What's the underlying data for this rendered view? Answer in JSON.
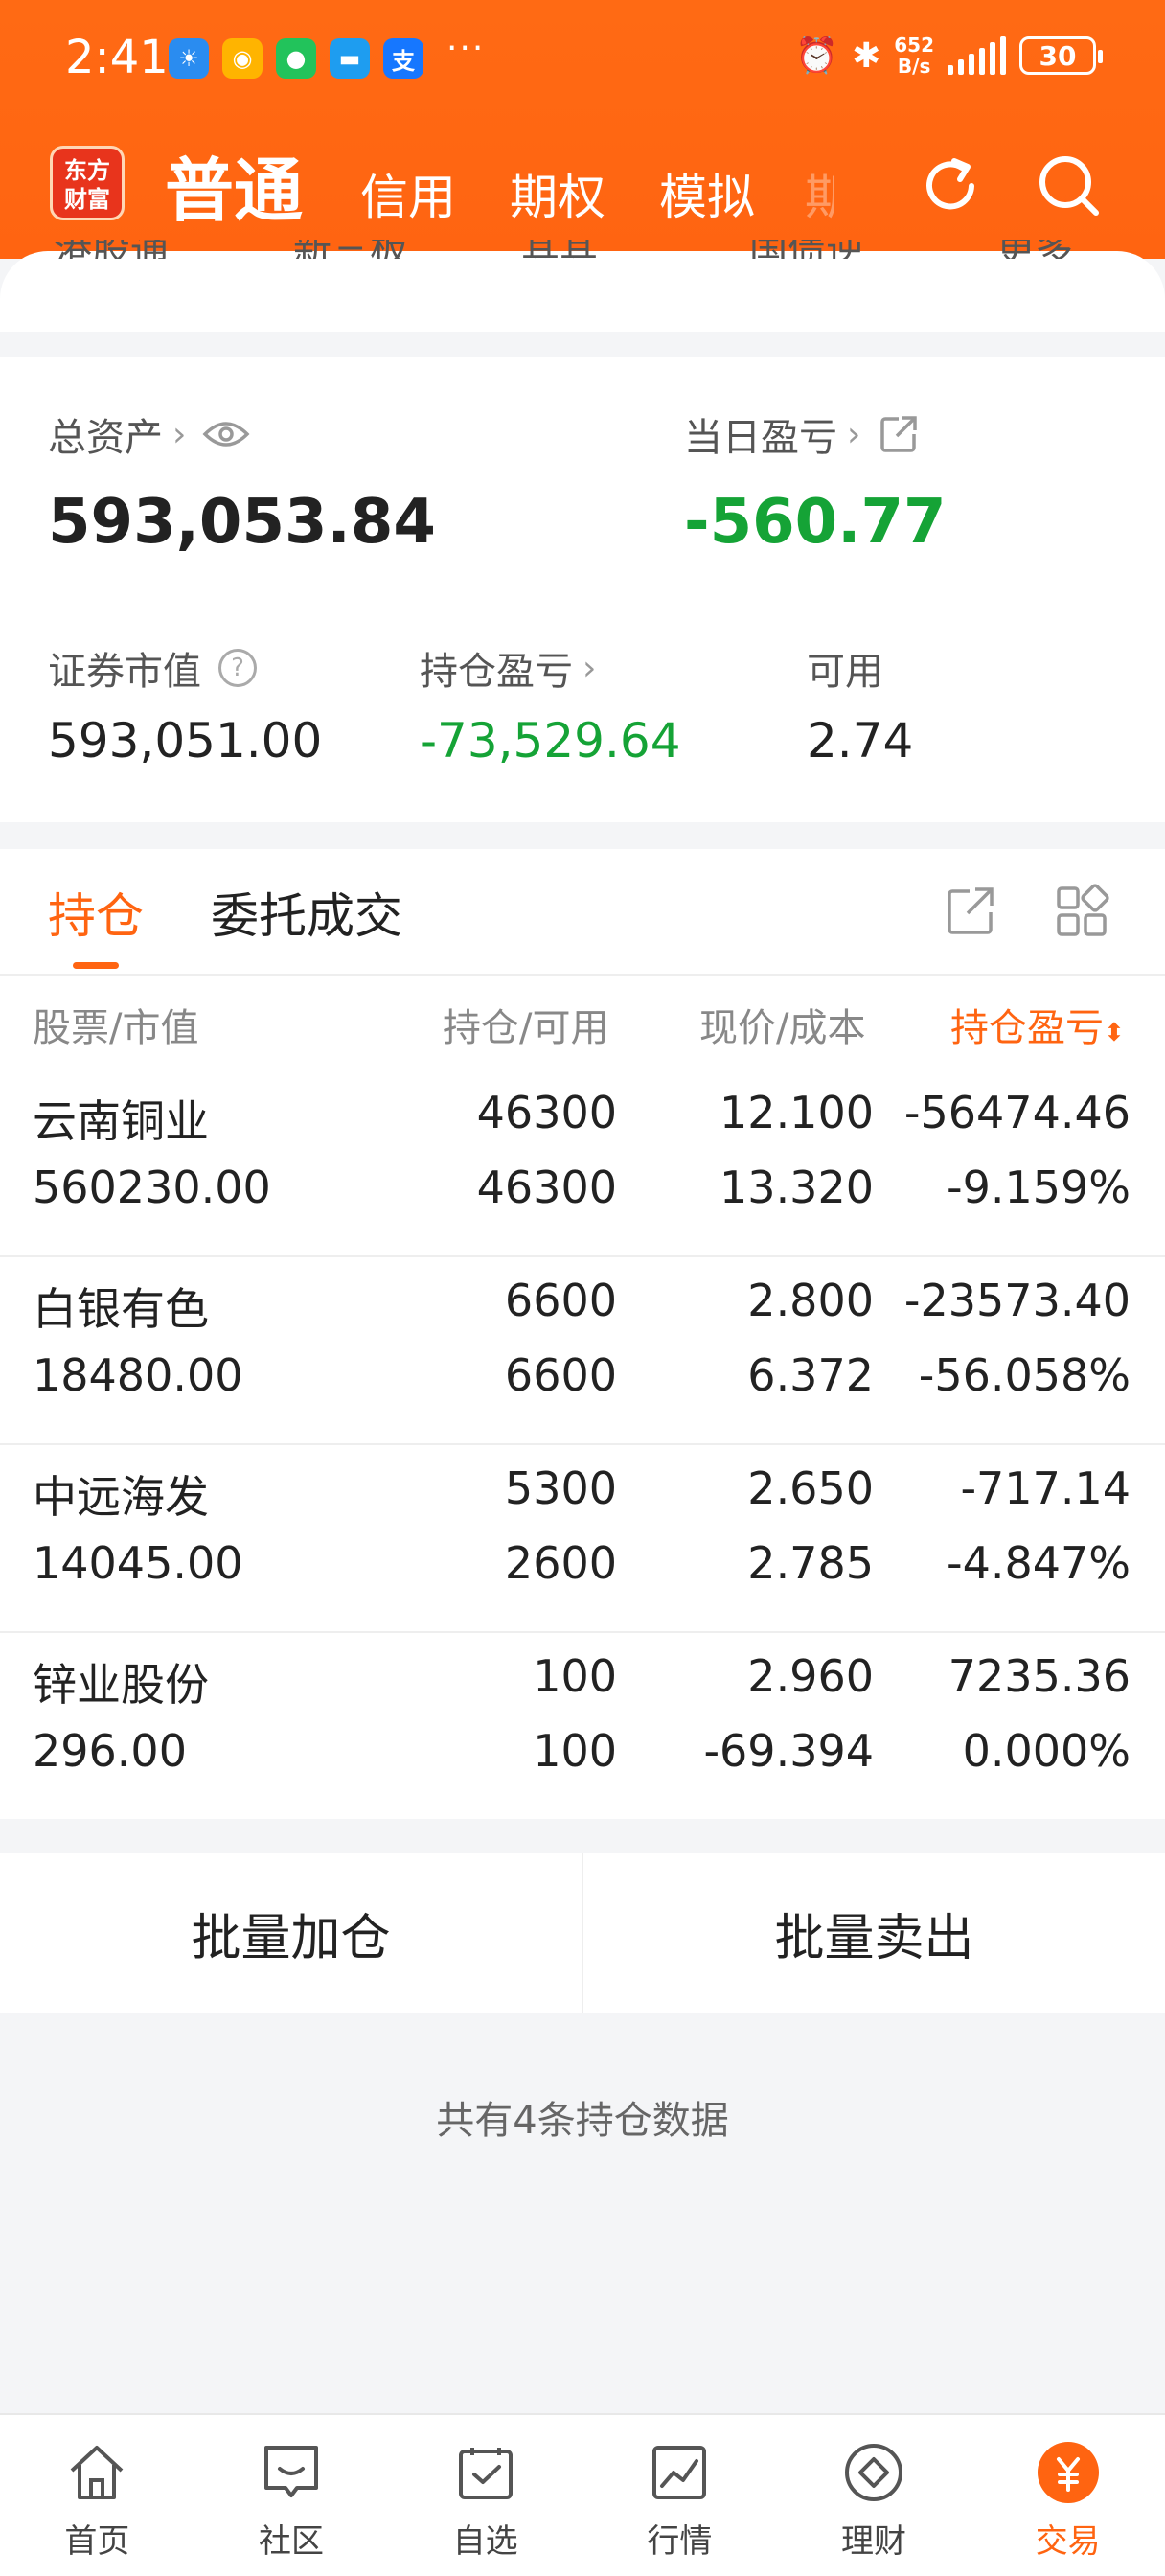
{
  "status_bar": {
    "time": "2:41",
    "more": "···",
    "net_speed_value": "652",
    "net_speed_unit": "B/s",
    "battery": "30"
  },
  "header": {
    "logo_line1": "东方",
    "logo_line2": "财富",
    "tabs": [
      "普通",
      "信用",
      "期权",
      "模拟"
    ],
    "tab_faded": "期"
  },
  "top_menu": [
    "港股通",
    "新三板",
    "其其",
    "国债逆",
    "更多"
  ],
  "assets": {
    "total_label": "总资产",
    "total_value": "593,053.84",
    "daily_pl_label": "当日盈亏",
    "daily_pl_value": "-560.77",
    "securities_label": "证券市值",
    "securities_value": "593,051.00",
    "position_pl_label": "持仓盈亏",
    "position_pl_value": "-73,529.64",
    "available_label": "可用",
    "available_value": "2.74"
  },
  "panel": {
    "tab_positions": "持仓",
    "tab_orders": "委托成交",
    "columns": [
      "股票/市值",
      "持仓/可用",
      "现价/成本",
      "持仓盈亏"
    ]
  },
  "holdings": [
    {
      "name": "云南铜业",
      "market_value": "560230.00",
      "qty": "46300",
      "available": "46300",
      "price": "12.100",
      "cost": "13.320",
      "pl": "-56474.46",
      "pl_pct": "-9.159%",
      "tone": "down"
    },
    {
      "name": "白银有色",
      "market_value": "18480.00",
      "qty": "6600",
      "available": "6600",
      "price": "2.800",
      "cost": "6.372",
      "pl": "-23573.40",
      "pl_pct": "-56.058%",
      "tone": "down"
    },
    {
      "name": "中远海发",
      "market_value": "14045.00",
      "qty": "5300",
      "available": "2600",
      "price": "2.650",
      "cost": "2.785",
      "pl": "-717.14",
      "pl_pct": "-4.847%",
      "tone": "down"
    },
    {
      "name": "锌业股份",
      "market_value": "296.00",
      "qty": "100",
      "available": "100",
      "price": "2.960",
      "cost": "-69.394",
      "pl": "7235.36",
      "pl_pct": "0.000%",
      "tone": "up"
    }
  ],
  "batch": {
    "add_label": "批量加仓",
    "sell_label": "批量卖出"
  },
  "footnote": "共有4条持仓数据",
  "bottom_nav": [
    "首页",
    "社区",
    "自选",
    "行情",
    "理财",
    "交易"
  ],
  "colors": {
    "brand_orange": "#ff6411",
    "gain_red": "#e02020",
    "loss_green": "#15a336"
  }
}
